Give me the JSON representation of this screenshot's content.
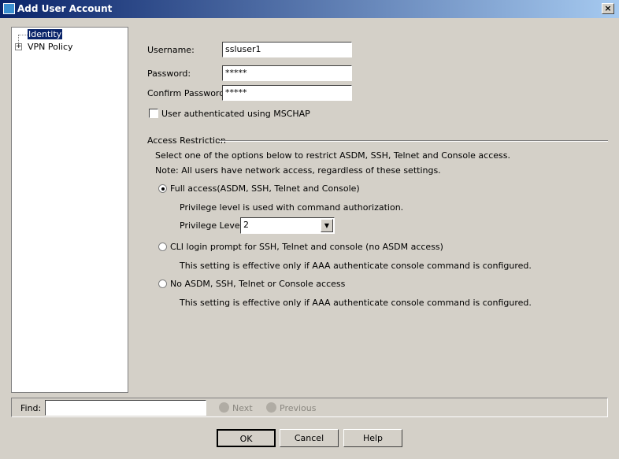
{
  "window": {
    "title": "Add User Account",
    "close": "×"
  },
  "tree": {
    "items": [
      {
        "label": "Identity",
        "selected": true
      },
      {
        "label": "VPN Policy",
        "expand": "+"
      }
    ]
  },
  "form": {
    "username_label": "Username:",
    "username": "ssluser1",
    "password_label": "Password:",
    "password": "*****",
    "confirm_label": "Confirm Password:",
    "confirm": "*****",
    "mschap_label": "User authenticated using MSCHAP",
    "mschap_checked": false
  },
  "access": {
    "legend": "Access Restriction",
    "intro": "Select one of the options below to restrict ASDM, SSH, Telnet and Console access.",
    "note": "Note: All users have network access, regardless of these settings.",
    "options": [
      {
        "label": "Full access(ASDM, SSH, Telnet and Console)",
        "selected": true,
        "desc": "Privilege level is used with command authorization."
      },
      {
        "label": "CLI login prompt for SSH, Telnet and console (no ASDM access)",
        "selected": false,
        "desc": "This setting is effective only if AAA authenticate console command is configured."
      },
      {
        "label": "No ASDM, SSH, Telnet or Console access",
        "selected": false,
        "desc": "This setting is effective only if AAA authenticate console command is configured."
      }
    ],
    "privilege_label": "Privilege Level:",
    "privilege_value": "2"
  },
  "find": {
    "label": "Find:",
    "value": "",
    "next": "Next",
    "previous": "Previous"
  },
  "buttons": {
    "ok": "OK",
    "cancel": "Cancel",
    "help": "Help"
  }
}
